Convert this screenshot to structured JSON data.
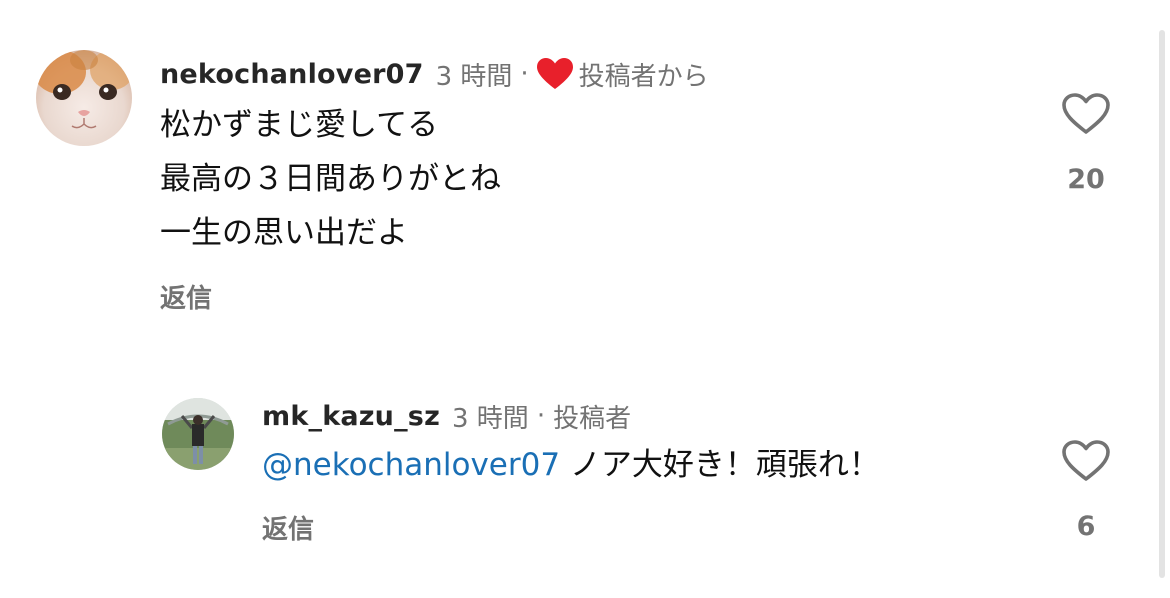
{
  "comment": {
    "username": "nekochanlover07",
    "time": "3 時間",
    "separator": "·",
    "creator_badge": "投稿者から",
    "lines": [
      "松かずまじ愛してる",
      "最高の３日間ありがとね",
      "一生の思い出だよ"
    ],
    "reply_label": "返信",
    "like_count": "20",
    "avatar_icon": "cat-avatar",
    "badge_icon": "heart-icon",
    "badge_color": "#e8202b"
  },
  "reply": {
    "username": "mk_kazu_sz",
    "time": "3 時間",
    "separator": "·",
    "author_label": "投稿者",
    "mention": "@nekochanlover07",
    "text": " ノア大好き！頑張れ！",
    "reply_label": "返信",
    "like_count": "6",
    "avatar_icon": "person-outdoor-avatar"
  },
  "colors": {
    "mention": "#1a6fb5",
    "muted": "#737373"
  }
}
